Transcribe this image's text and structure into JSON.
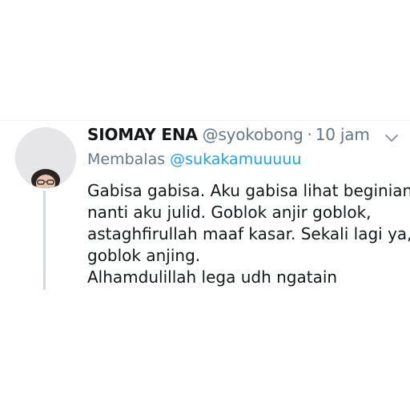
{
  "tweet": {
    "display_name": "SIOMAY ENA",
    "handle": "@syokobong",
    "separator": "·",
    "time": "10 jam",
    "reply_prefix": "Membalas",
    "reply_handle": "@sukakamuuuuu",
    "text_lines": [
      "Gabisa gabisa. Aku gabisa lihat beginian,",
      "nanti aku julid. Goblok anjir goblok,",
      "astaghfirullah maaf kasar. Sekali lagi ya,",
      "goblok anjing.",
      "Alhamdulillah lega udh ngatain"
    ]
  },
  "icons": {
    "menu": "chevron-down-icon"
  },
  "colors": {
    "name": "#14171a",
    "secondary": "#657786",
    "link": "#1da1f2",
    "thread_line": "#cfd9de"
  }
}
